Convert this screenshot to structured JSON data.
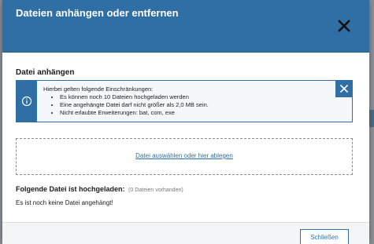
{
  "dialog": {
    "title": "Dateien anhängen oder entfernen",
    "close_icon": "close-icon"
  },
  "attach_section": {
    "title": "Datei anhängen"
  },
  "info_box": {
    "icon": "info-icon",
    "intro": "Hierbei gelten folgende Einschränkungen:",
    "rules": [
      "Es können noch 10 Dateien hochgeladen werden",
      "Eine angehängte Datei darf nicht größer als 2,0 MB sein.",
      "Nicht erlaubte Erweiterungen: bat, com, exe"
    ],
    "close_icon": "close-icon",
    "accent_color": "#2f6fa3"
  },
  "dropzone": {
    "link_text": "Datei auswählen oder hier ablegen"
  },
  "uploaded": {
    "title": "Folgende Datei ist hochgeladen:",
    "count_text": "(0 Dateien vorhanden)",
    "empty_text": "Es ist noch keine Datei angehängt!"
  },
  "footer": {
    "close_label": "Schließen"
  },
  "colors": {
    "header": "#2f6fa3",
    "link": "#2f6fa3"
  }
}
